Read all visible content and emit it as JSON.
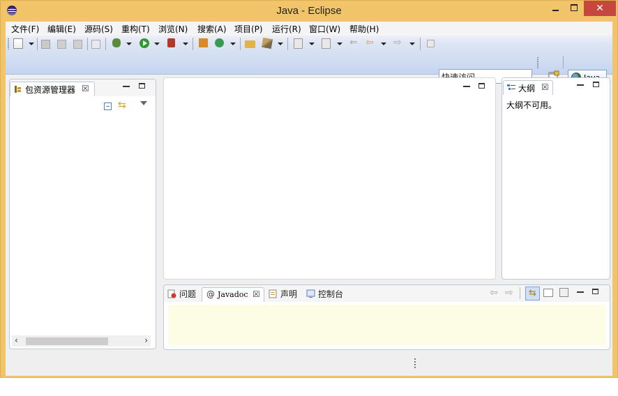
{
  "window": {
    "title": "Java - Eclipse",
    "close_glyph": "✕"
  },
  "menubar": {
    "items": [
      "文件(F)",
      "编辑(E)",
      "源码(S)",
      "重构(T)",
      "浏览(N)",
      "搜索(A)",
      "项目(P)",
      "运行(R)",
      "窗口(W)",
      "帮助(H)"
    ]
  },
  "toolbar": {
    "quick_access_value": "快速访问",
    "perspective_label": "Java"
  },
  "package_explorer": {
    "tab_label": "包资源管理器",
    "close_glyph": "☒",
    "scroll_left_glyph": "‹",
    "scroll_right_glyph": "›"
  },
  "outline": {
    "tab_label": "大纲",
    "close_glyph": "☒",
    "message": "大纲不可用。"
  },
  "bottom_panel": {
    "tabs": [
      "问题",
      "Javadoc",
      "声明",
      "控制台"
    ],
    "active_tab": "Javadoc",
    "javadoc_prefix": "@",
    "close_glyph": "☒"
  },
  "colors": {
    "title_bar": "#f2c46a",
    "close_button": "#c7463e",
    "toolbar_gradient_end": "#c5d5f0",
    "javadoc_bg": "#fdfde6"
  },
  "icons": [
    "eclipse-logo-icon",
    "new-file-icon",
    "save-icon",
    "print-icon",
    "debug-icon",
    "run-icon",
    "external-tools-icon",
    "new-package-icon",
    "new-class-icon",
    "open-folder-icon",
    "pencil-icon",
    "back-icon",
    "forward-icon",
    "open-perspective-icon",
    "java-perspective-icon",
    "collapse-all-icon",
    "link-with-editor-icon",
    "view-menu-icon",
    "package-explorer-icon",
    "outline-icon",
    "problems-icon",
    "declaration-icon",
    "console-icon"
  ]
}
